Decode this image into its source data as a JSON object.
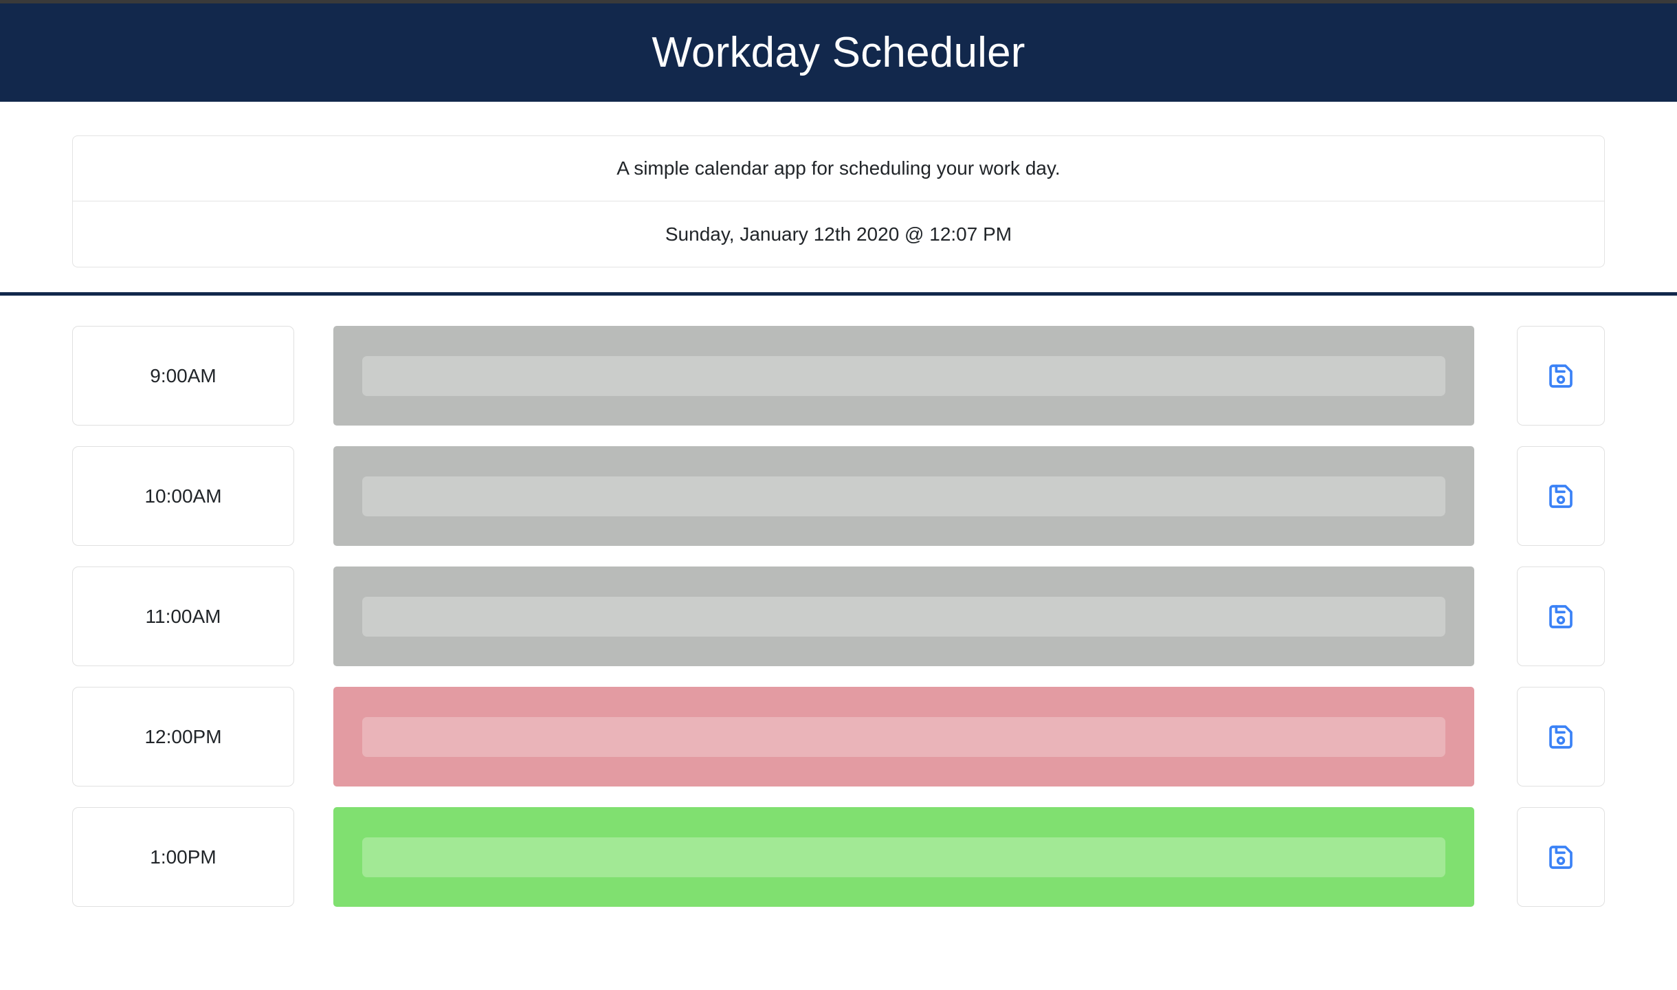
{
  "app": {
    "title": "Workday Scheduler",
    "header_bg": "#12284c",
    "header_text_color": "#ffffff"
  },
  "jumbotron": {
    "tagline": "A simple calendar app for scheduling your work day.",
    "current_datetime": "Sunday, January 12th 2020 @ 12:07 PM"
  },
  "schedule": {
    "save_icon_name": "save-icon",
    "save_icon_color": "#3b82f6",
    "blocks": [
      {
        "hour": "9:00AM",
        "text": "",
        "state": "past",
        "state_color": "#b9bbb9",
        "inner_color": "#cbcdcb"
      },
      {
        "hour": "10:00AM",
        "text": "",
        "state": "past",
        "state_color": "#b9bbb9",
        "inner_color": "#cbcdcb"
      },
      {
        "hour": "11:00AM",
        "text": "",
        "state": "past",
        "state_color": "#b9bbb9",
        "inner_color": "#cbcdcb"
      },
      {
        "hour": "12:00PM",
        "text": "",
        "state": "present",
        "state_color": "#e39ba2",
        "inner_color": "#eab4b9"
      },
      {
        "hour": "1:00PM",
        "text": "",
        "state": "future",
        "state_color": "#80e070",
        "inner_color": "#a2e995"
      }
    ]
  }
}
